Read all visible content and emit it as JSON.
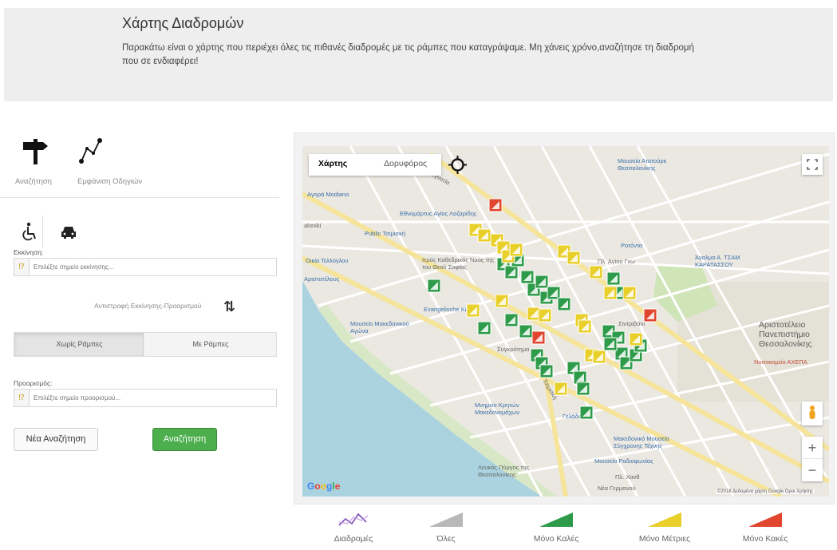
{
  "header": {
    "title": "Χάρτης Διαδρομών",
    "description": "Παρακάτω είναι ο χάρτης που περιέχει όλες τις πιθανές διαδρομές με τις ράμπες που καταγράψαμε. Μη χάνεις χρόνο,αναζήτησε τη διαδρομή που σε ενδιαφέρει!"
  },
  "sidebar": {
    "top_buttons": [
      {
        "label": "Αναζήτηση",
        "icon": "signpost-icon"
      },
      {
        "label": "Εμφάνιση Οδηγιών",
        "icon": "route-icon"
      }
    ],
    "modes": [
      {
        "icon": "wheelchair-icon"
      },
      {
        "icon": "car-icon"
      }
    ],
    "start": {
      "label": "Εκκίνηση:",
      "placeholder": "Επιλέξτε σημείο εκκίνησης..."
    },
    "swap_label": "Αντιστροφή Εκκίνησης-Προορισμού",
    "ramp_options": {
      "without": "Χωρίς Ράμπες",
      "with": "Με Ράμπες",
      "selected": "without"
    },
    "destination": {
      "label": "Προορισμός:",
      "placeholder": "Επιλέξτε σημείο προορισμού..."
    },
    "new_search": "Νέα Αναζήτηση",
    "search": "Αναζήτηση"
  },
  "map": {
    "map_type": {
      "map": "Χάρτης",
      "satellite": "Δορυφόρος",
      "selected": "map"
    },
    "zoom_in": "+",
    "zoom_out": "−",
    "logo": "Google",
    "attribution": "©2018 Δεδομένα χάρτη Google   Όροι Χρήσης",
    "places": {
      "agora": "Αγορά Modiano",
      "ethnomartyr": "Εθνομάρτυς Αγίας Λαζαρίδης",
      "public": "Public Τσιμισκή",
      "salonica": "alonikí",
      "oikia": "Οικία Τελλόγλου",
      "aristotelous": "Αριστοτέλους",
      "ieros": "Ιερός Καθεδρικός Ναός της του Θεού Σοφίας",
      "evangelische": "Evangelische Kirche",
      "mouseio_makedonikou": "Μουσείο Μακεδονικού Αγώνα",
      "ano_synkrotima": "Συγκρότημα",
      "mouseio_ataturk": "Μουσείο Ατατούρκ Θεσσαλονίκης",
      "rotonda": "Ροτόντα",
      "pl_agiou": "Πλ. Αγίου Γεω",
      "agalma": "Άγαλμα Α. ΤΣΑΜ ΚΑΡΑΤΑΣΣΟΥ",
      "syntrivani": "Σιντριβάνι",
      "aristoteleio": "Αριστοτέλειο Πανεπιστήμιο Θεσσαλονίκης",
      "nosokomeio": "Νοσοκομείο ΑΧΕΠΑ",
      "mnimeio": "Μνημείο Κρητών Μακεδονομάχων",
      "gelada": "Γελάδα",
      "makedoniko_mouseio": "Μακεδονικό Μουσείο Σύγχρονης Τέχνης",
      "mouseio_radiofonias": "Μουσείο Ραδιοφωνίας",
      "pyrgos": "Λευκός Πύργος της Θεσσαλονίκης",
      "pl_chani": "Πλ. Χανθ",
      "pl_gervaniou": "Νέα Γερμανού",
      "egnatia": "Εγνατία",
      "tsimiski": "Τσιμισκή"
    }
  },
  "legend": [
    {
      "label": "Διαδρομές",
      "color": "#7b4fb6"
    },
    {
      "label": "Όλες",
      "color": "#b8b8b8"
    },
    {
      "label": "Μόνο Καλές",
      "color": "#2e9b4a"
    },
    {
      "label": "Μόνο Μέτριες",
      "color": "#e9cf2a"
    },
    {
      "label": "Μόνο Κακές",
      "color": "#e0452d"
    }
  ],
  "colors": {
    "ramp_good": "#2e9b4a",
    "ramp_medium": "#e9cf2a",
    "ramp_bad": "#e0452d",
    "search_button": "#4cae4c"
  }
}
